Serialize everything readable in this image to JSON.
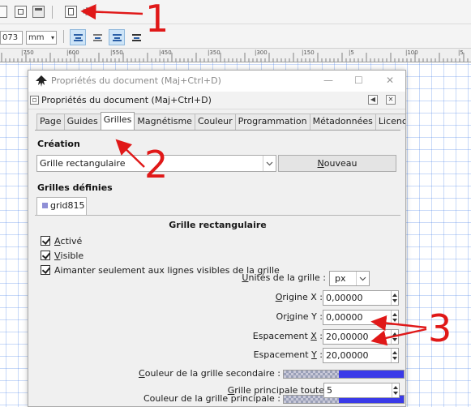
{
  "toolbar2": {
    "value_field": "073",
    "unit": "mm"
  },
  "ruler": {
    "labels": [
      "|750",
      "|600",
      "|550",
      "|450",
      "|350",
      "|300",
      "|150",
      "|5",
      "|100",
      "|5"
    ]
  },
  "dialog": {
    "window_title": "Propriétés du document (Maj+Ctrl+D)",
    "minimize_glyph": "—",
    "maximize_glyph": "☐",
    "close_glyph": "✕",
    "panel_title": "Propriétés du document (Maj+Ctrl+D)",
    "tabs": [
      {
        "label": "Page"
      },
      {
        "label": "Guides"
      },
      {
        "label": "Grilles"
      },
      {
        "label": "Magnétisme"
      },
      {
        "label": "Couleur"
      },
      {
        "label": "Programmation"
      },
      {
        "label": "Métadonnées"
      },
      {
        "label": "Licence"
      }
    ],
    "active_tab": "Grilles",
    "creation": {
      "title": "Création",
      "grid_type": "Grille rectangulaire",
      "new_button_first": "N",
      "new_button_rest": "ouveau"
    },
    "defined": {
      "title": "Grilles définies",
      "grid_name": "grid815"
    },
    "grid": {
      "title": "Grille rectangulaire",
      "enabled": {
        "first": "A",
        "rest": "ctivé",
        "checked": true
      },
      "visible": {
        "first": "V",
        "rest": "isible",
        "checked": true
      },
      "snap_visible": {
        "label": "Aimanter seulement aux lignes visibles de la grille",
        "checked": true
      },
      "units": {
        "label_first": "U",
        "label_rest": "nités de la grille :",
        "value": "px"
      },
      "origin_x": {
        "label_pre": "O",
        "label_rest": "rigine X :",
        "value": "0,00000"
      },
      "origin_y": {
        "label_pre": "O",
        "label_mid": "r",
        "label_u": "i",
        "label_rest": "gine Y :",
        "value": "0,00000"
      },
      "spacing_x": {
        "label_pre": "Espacement ",
        "label_u": "X",
        "label_rest": " :",
        "value": "20,00000"
      },
      "spacing_y": {
        "label_pre": "Espacement ",
        "label_u": "Y",
        "label_rest": " :",
        "value": "20,00000"
      },
      "minor_color": {
        "label_u": "C",
        "label_rest": "ouleur de la grille secondaire :",
        "color": "#3a3ae8"
      },
      "major_color": {
        "label": "Couleur de la grille principale :",
        "color": "#3a3ae8"
      },
      "major_every": {
        "label_u": "G",
        "label_rest": "rille principale toutes les :",
        "value": "5"
      }
    }
  },
  "annotations": {
    "one": "1",
    "two": "2",
    "three": "3",
    "color": "#e01818"
  }
}
